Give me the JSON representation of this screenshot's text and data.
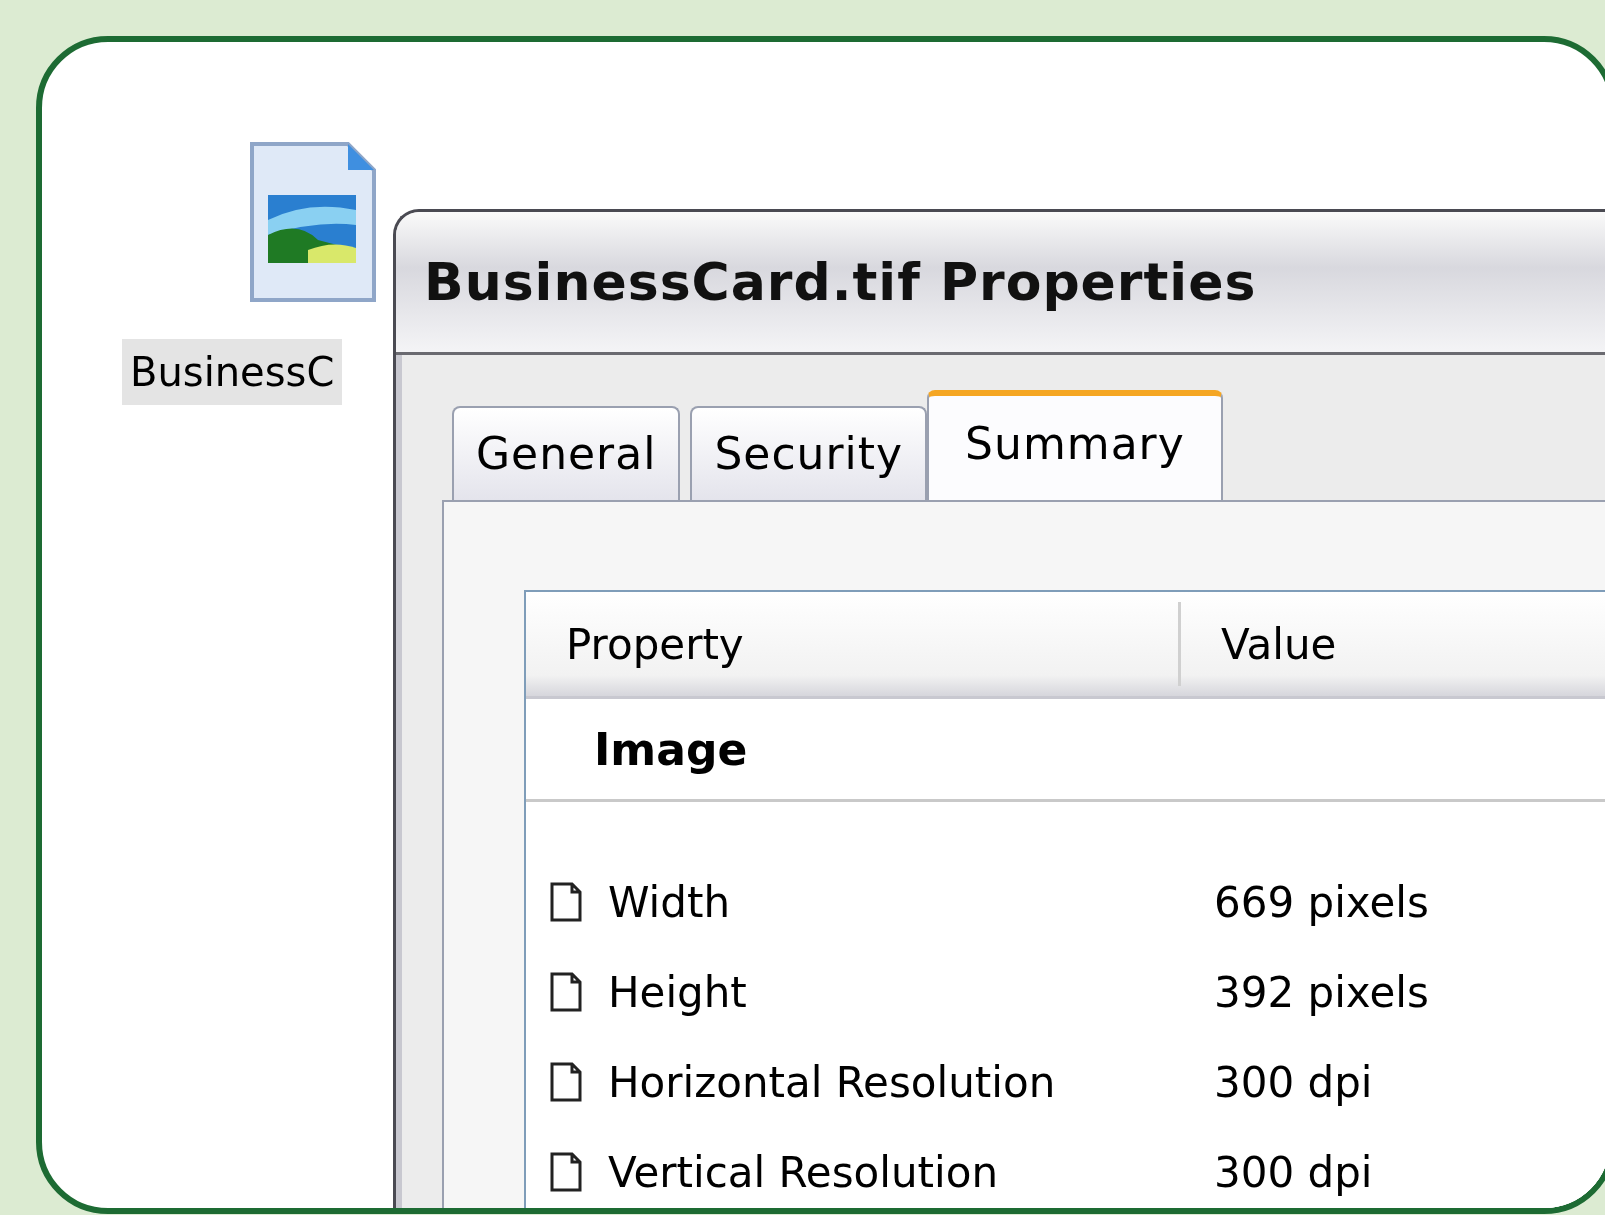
{
  "desktop_icon": {
    "label": "BusinessC"
  },
  "window": {
    "title": "BusinessCard.tif Properties"
  },
  "tabs": [
    {
      "label": "General",
      "selected": false
    },
    {
      "label": "Security",
      "selected": false
    },
    {
      "label": "Summary",
      "selected": true
    }
  ],
  "table": {
    "columns": [
      "Property",
      "Value"
    ],
    "groups": [
      {
        "name": "Image",
        "rows": [
          {
            "property": "Width",
            "value": "669 pixels"
          },
          {
            "property": "Height",
            "value": "392 pixels"
          },
          {
            "property": "Horizontal Resolution",
            "value": "300 dpi"
          },
          {
            "property": "Vertical Resolution",
            "value": "300 dpi"
          }
        ]
      }
    ]
  }
}
